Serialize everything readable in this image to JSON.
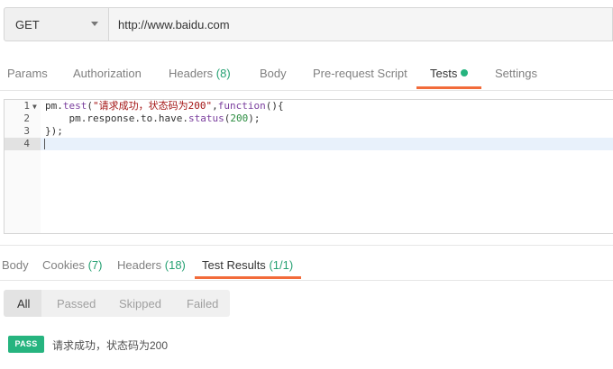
{
  "request": {
    "method": "GET",
    "url": "http://www.baidu.com"
  },
  "request_tabs": [
    {
      "label": "Params"
    },
    {
      "label": "Authorization"
    },
    {
      "label": "Headers",
      "count": "(8)"
    },
    {
      "label": "Body"
    },
    {
      "label": "Pre-request Script"
    },
    {
      "label": "Tests",
      "active": true
    },
    {
      "label": "Settings"
    }
  ],
  "editor": {
    "line_numbers": [
      "1",
      "2",
      "3",
      "4"
    ],
    "lines": [
      "pm.test(\"请求成功，状态码为200\",function(){",
      "    pm.response.to.have.status(200);",
      "});",
      ""
    ]
  },
  "response_tabs": [
    {
      "label": "Body"
    },
    {
      "label": "Cookies",
      "count": "(7)"
    },
    {
      "label": "Headers",
      "count": "(18)"
    },
    {
      "label": "Test Results",
      "count": "(1/1)",
      "active": true
    }
  ],
  "filters": [
    "All",
    "Passed",
    "Skipped",
    "Failed"
  ],
  "result": {
    "status": "PASS",
    "text": "请求成功，状态码为200"
  },
  "colors": {
    "accent": "#f26b3a",
    "pass": "#26b47f",
    "count": "#26a173"
  }
}
